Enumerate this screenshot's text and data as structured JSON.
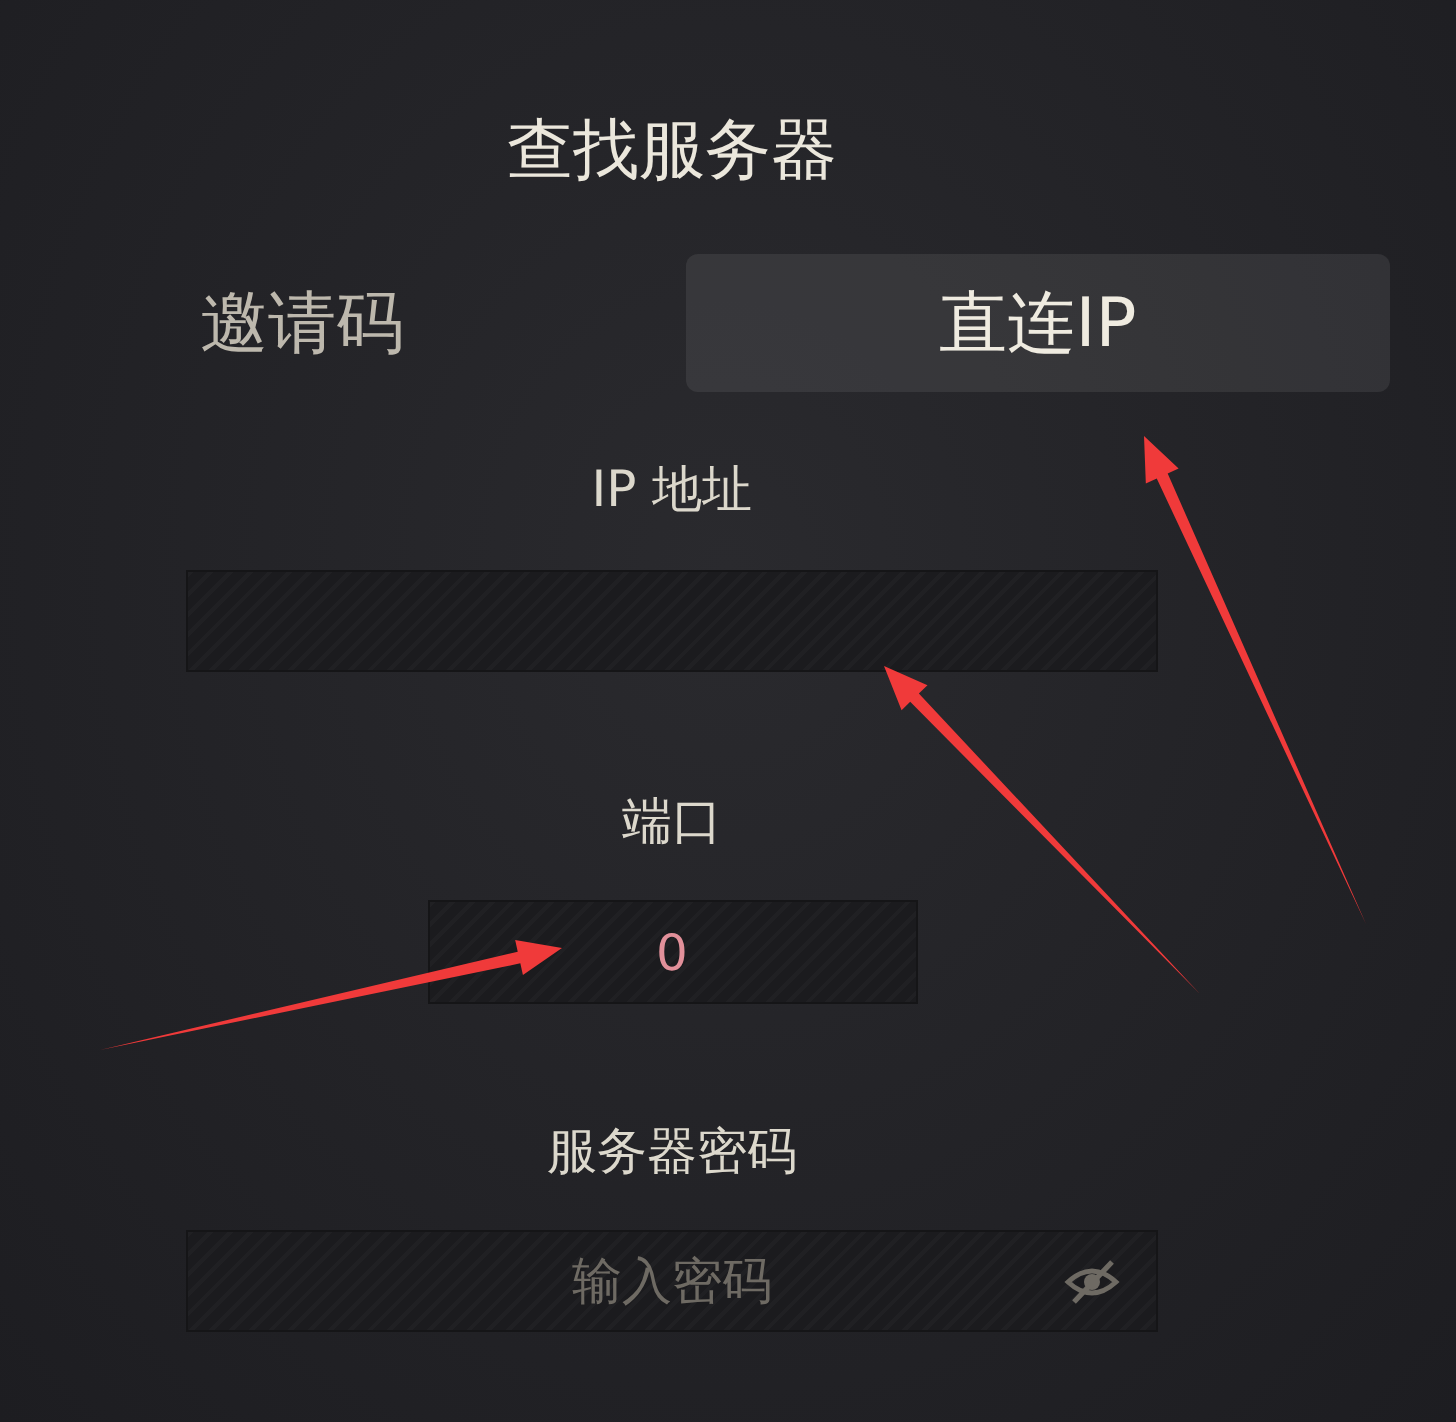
{
  "title": "查找服务器",
  "tabs": [
    {
      "label": "邀请码",
      "selected": false
    },
    {
      "label": "直连IP",
      "selected": true
    }
  ],
  "ip_address": {
    "label": "IP 地址"
  },
  "port": {
    "label": "端口",
    "value": "0"
  },
  "server_password": {
    "label": "服务器密码",
    "placeholder": "输入密码",
    "visible": false
  }
}
